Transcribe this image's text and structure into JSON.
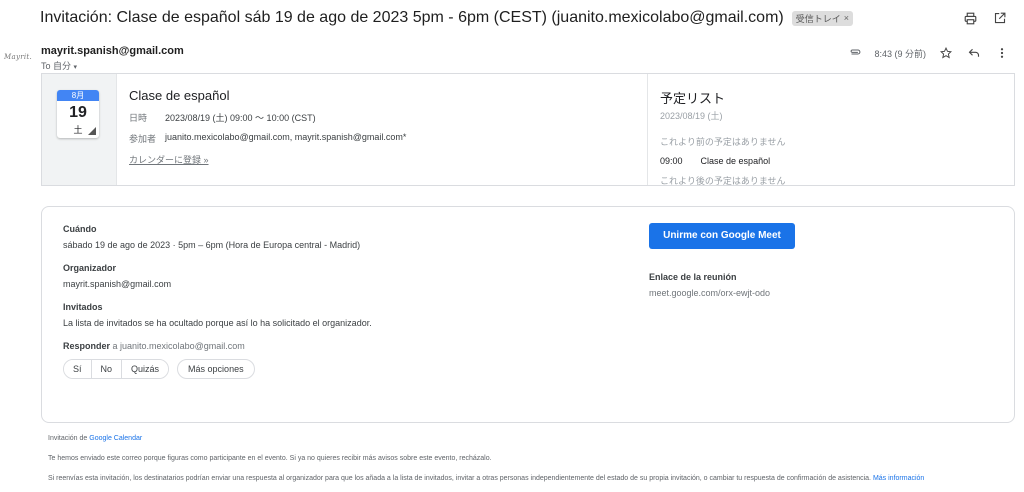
{
  "header": {
    "subject": "Invitación: Clase de español sáb 19 de ago de 2023 5pm - 6pm (CEST) (juanito.mexicolabo@gmail.com)",
    "inbox_label": "受信トレイ",
    "inbox_close": "×",
    "print_icon": "printer-icon",
    "open_icon": "open-in-new-window-icon"
  },
  "avatar_text": "Mayrit.",
  "sender": {
    "email": "mayrit.spanish@gmail.com",
    "to_label": "To 自分",
    "to_caret": "▾"
  },
  "meta": {
    "time": "8:43 (9 分前)",
    "icons": [
      "attachment-icon",
      "star-icon",
      "reply-icon",
      "more-vert-icon"
    ]
  },
  "invite": {
    "cal_month": "8月",
    "cal_day": "19",
    "cal_dow": "土",
    "title": "Clase de español",
    "date_label": "日時",
    "date_value": "2023/08/19 (土) 09:00 ～ 10:00 (CST)",
    "guests_label": "参加者",
    "guests_value": "juanito.mexicolabo@gmail.com, mayrit.spanish@gmail.com*",
    "add_calendar": "カレンダーに登録 »"
  },
  "agenda": {
    "title": "予定リスト",
    "date": "2023/08/19 (土)",
    "before": "これより前の予定はありません",
    "item_time": "09:00",
    "item_title": "Clase de español",
    "after": "これより後の予定はありません"
  },
  "details": {
    "when_label": "Cuándo",
    "when_value": "sábado 19 de ago de 2023 · 5pm – 6pm (Hora de Europa central - Madrid)",
    "organizer_label": "Organizador",
    "organizer_value": "mayrit.spanish@gmail.com",
    "guests_label": "Invitados",
    "guests_value": "La lista de invitados se ha ocultado porque así lo ha solicitado el organizador.",
    "respond_label": "Responder",
    "respond_to": "a juanito.mexicolabo@gmail.com",
    "rsvp_yes": "Sí",
    "rsvp_no": "No",
    "rsvp_maybe": "Quizás",
    "more_options": "Más opciones",
    "meet_button": "Unirme con Google Meet",
    "link_label": "Enlace de la reunión",
    "link_value": "meet.google.com/orx-ewjt-odo"
  },
  "footer": {
    "invitation_from": "Invitación de",
    "google_calendar": "Google Calendar",
    "line2": "Te hemos enviado este correo porque figuras como participante en el evento. Si ya no quieres recibir más avisos sobre este evento, recházalo.",
    "line3": "Si reenvías esta invitación, los destinatarios podrían enviar una respuesta al organizador para que los añada a la lista de invitados, invitar a otras personas independientemente del estado de su propia invitación, o cambiar tu respuesta de confirmación de asistencia.",
    "more_info": "Más información"
  },
  "colors": {
    "primary_blue": "#1a73e8",
    "calendar_blue": "#4285f4",
    "border": "#dadce0"
  }
}
